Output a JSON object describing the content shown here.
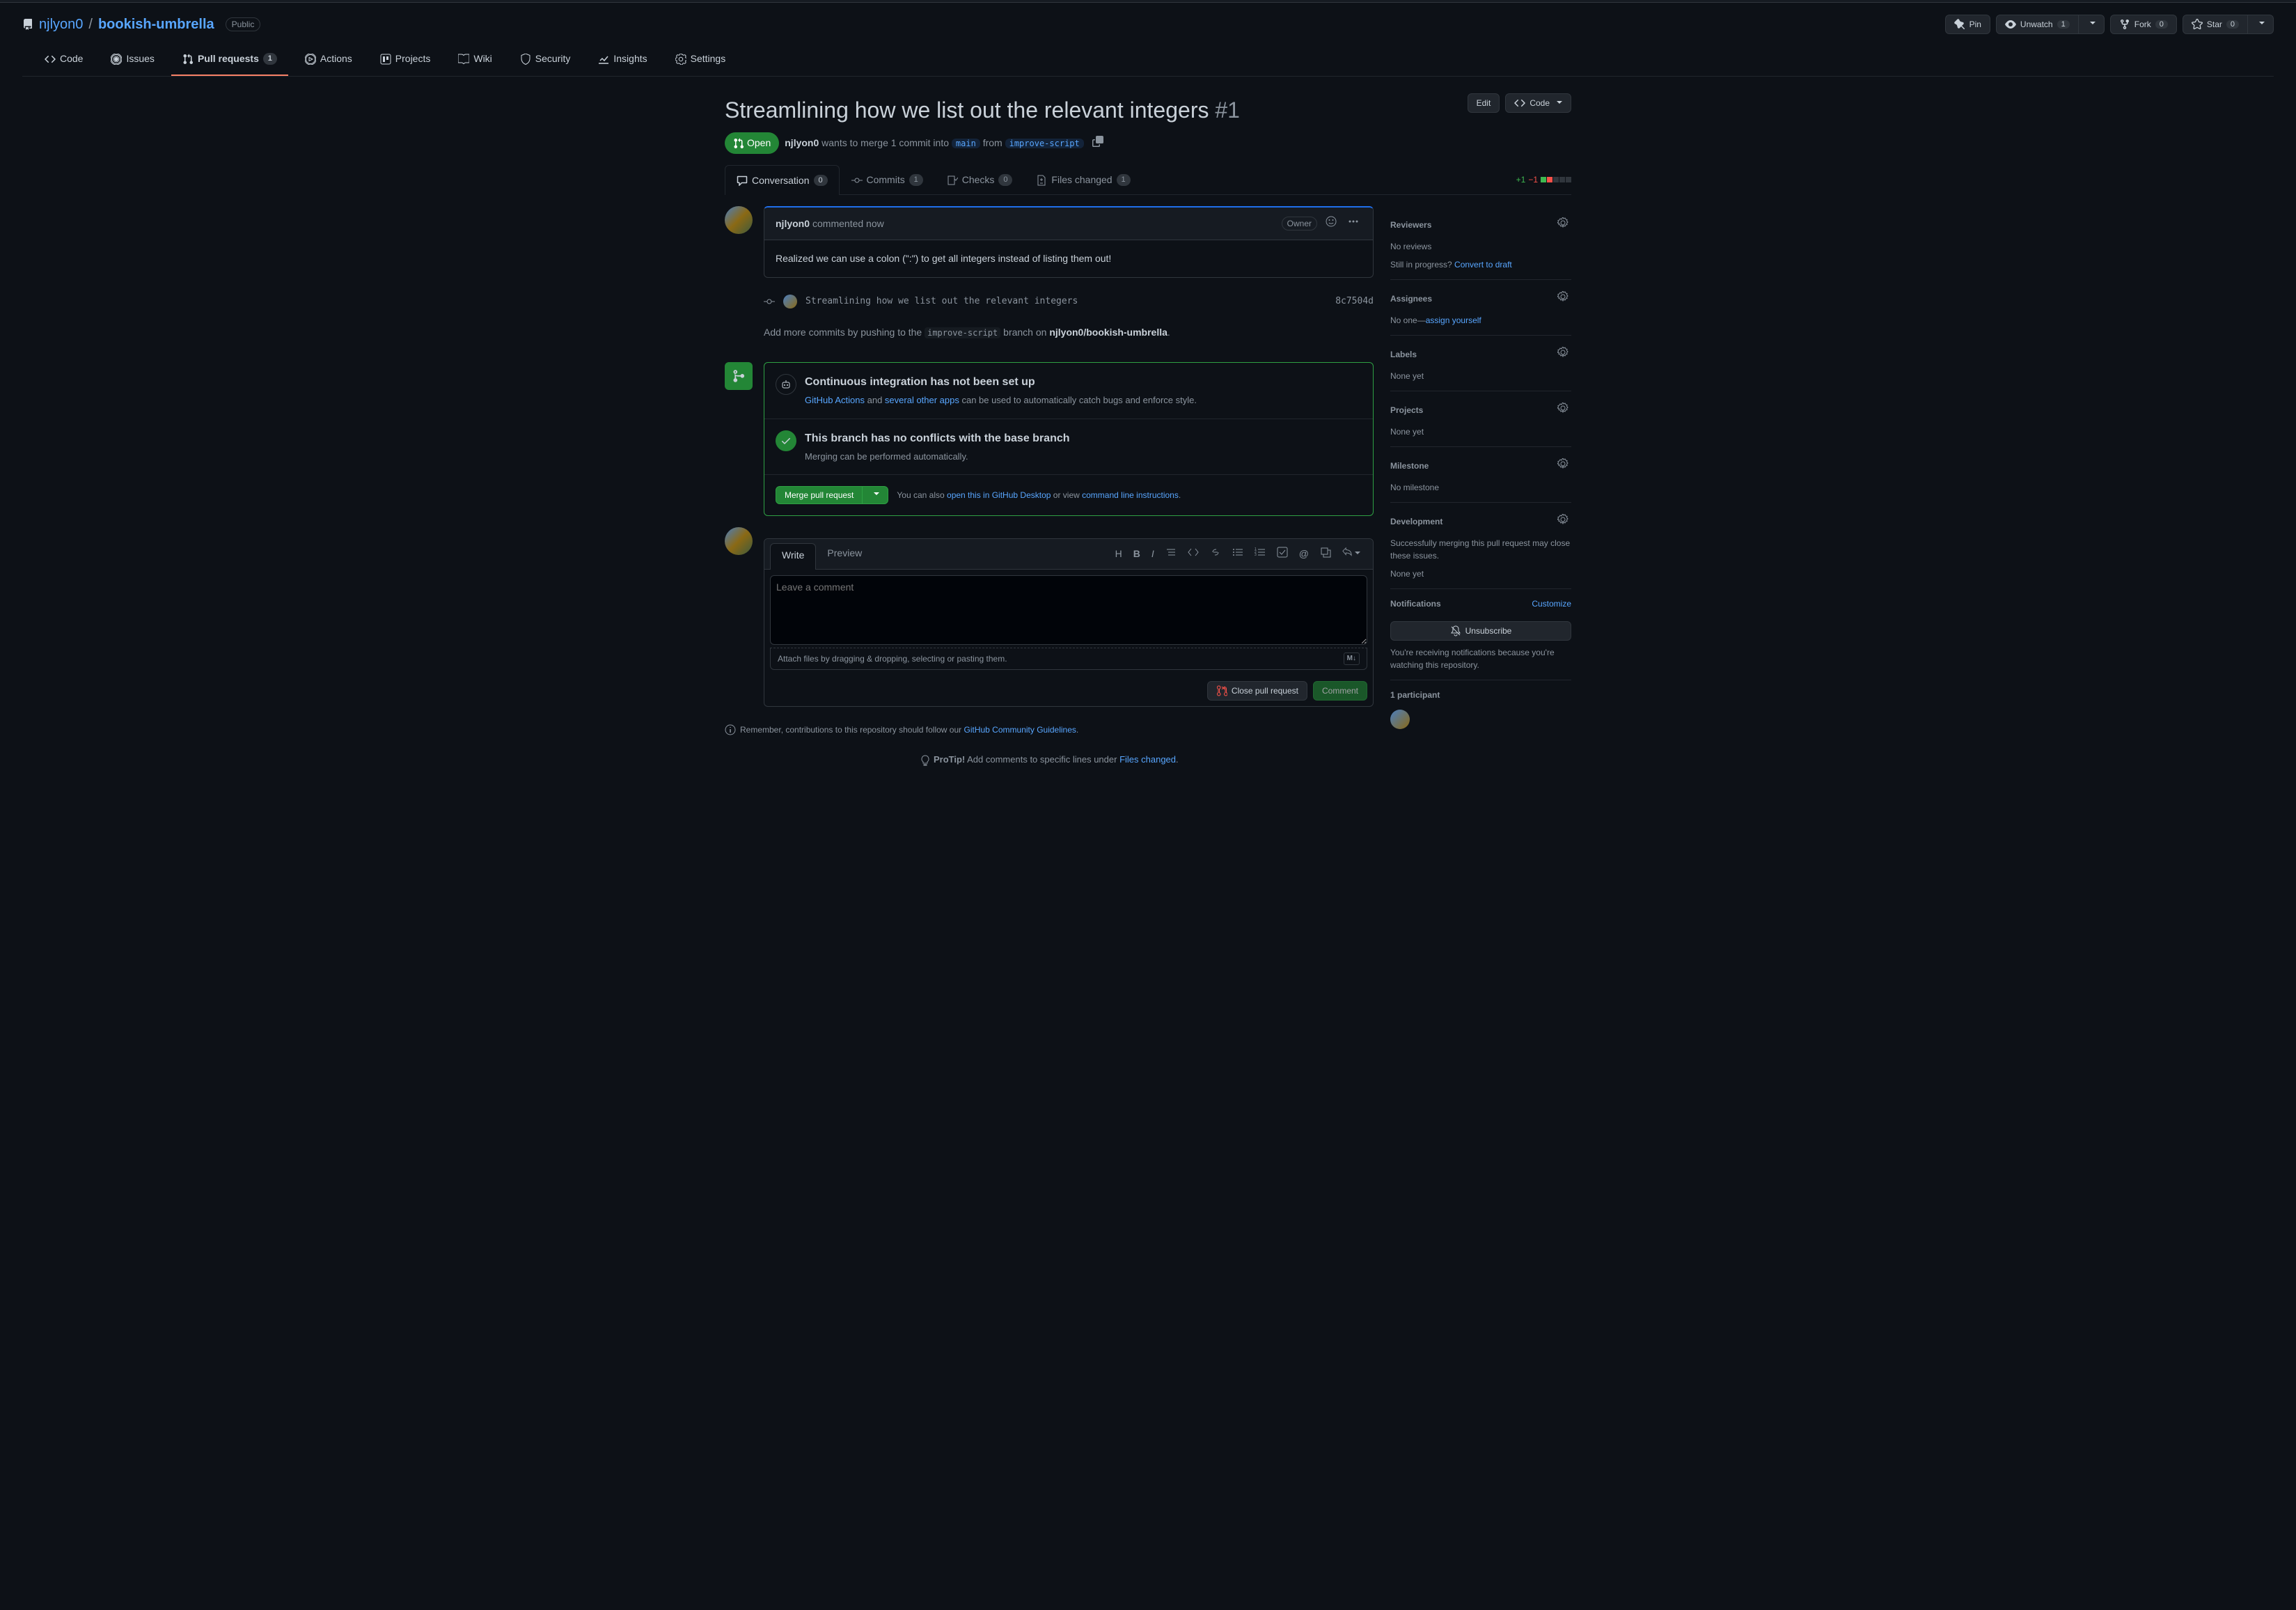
{
  "repo": {
    "owner": "njlyon0",
    "name": "bookish-umbrella",
    "visibility": "Public"
  },
  "repoActions": {
    "pin": "Pin",
    "watch": {
      "label": "Unwatch",
      "count": "1"
    },
    "fork": {
      "label": "Fork",
      "count": "0"
    },
    "star": {
      "label": "Star",
      "count": "0"
    }
  },
  "repoNav": {
    "code": "Code",
    "issues": "Issues",
    "pulls": {
      "label": "Pull requests",
      "count": "1"
    },
    "actions": "Actions",
    "projects": "Projects",
    "wiki": "Wiki",
    "security": "Security",
    "insights": "Insights",
    "settings": "Settings"
  },
  "pr": {
    "title": "Streamlining how we list out the relevant integers",
    "number": "#1",
    "state": "Open",
    "author": "njlyon0",
    "metaPrefix": " wants to merge 1 commit into ",
    "base": "main",
    "metaMiddle": " from ",
    "head": "improve-script",
    "editBtn": "Edit",
    "codeBtn": "Code"
  },
  "prTabs": {
    "conversation": {
      "label": "Conversation",
      "count": "0"
    },
    "commits": {
      "label": "Commits",
      "count": "1"
    },
    "checks": {
      "label": "Checks",
      "count": "0"
    },
    "files": {
      "label": "Files changed",
      "count": "1"
    }
  },
  "diffstat": {
    "add": "+1",
    "del": "−1"
  },
  "comment": {
    "author": "njlyon0",
    "timestamp": "commented now",
    "ownerBadge": "Owner",
    "body": "Realized we can use a colon (\":\") to get all integers instead of listing them out!"
  },
  "commit": {
    "message": "Streamlining how we list out the relevant integers",
    "sha": "8c7504d"
  },
  "pushHint": {
    "prefix": "Add more commits by pushing to the ",
    "branch": "improve-script",
    "middle": " branch on ",
    "repo": "njlyon0/bookish-umbrella",
    "suffix": "."
  },
  "ci": {
    "title": "Continuous integration has not been set up",
    "actionsLink": "GitHub Actions",
    "and": " and ",
    "appsLink": "several other apps",
    "rest": " can be used to automatically catch bugs and enforce style."
  },
  "conflicts": {
    "title": "This branch has no conflicts with the base branch",
    "subtitle": "Merging can be performed automatically."
  },
  "mergeActions": {
    "mergeBtn": "Merge pull request",
    "also": "You can also ",
    "desktopLink": "open this in GitHub Desktop",
    "or": " or view ",
    "cliLink": "command line instructions",
    "dot": "."
  },
  "commentForm": {
    "writeTab": "Write",
    "previewTab": "Preview",
    "placeholder": "Leave a comment",
    "attachHint": "Attach files by dragging & dropping, selecting or pasting them.",
    "closeBtn": "Close pull request",
    "commentBtn": "Comment",
    "mdBadge": "M↓"
  },
  "guideline": {
    "prefix": "Remember, contributions to this repository should follow our ",
    "link": "GitHub Community Guidelines",
    "suffix": "."
  },
  "protip": {
    "label": "ProTip!",
    "text": " Add comments to specific lines under ",
    "link": "Files changed",
    "suffix": "."
  },
  "sidebar": {
    "reviewers": {
      "title": "Reviewers",
      "body": "No reviews",
      "draft_prefix": "Still in progress? ",
      "draft_link": "Convert to draft"
    },
    "assignees": {
      "title": "Assignees",
      "body_prefix": "No one—",
      "body_link": "assign yourself"
    },
    "labels": {
      "title": "Labels",
      "body": "None yet"
    },
    "projects": {
      "title": "Projects",
      "body": "None yet"
    },
    "milestone": {
      "title": "Milestone",
      "body": "No milestone"
    },
    "development": {
      "title": "Development",
      "body": "Successfully merging this pull request may close these issues.",
      "none": "None yet"
    },
    "notifications": {
      "title": "Notifications",
      "customize": "Customize",
      "unsubscribe": "Unsubscribe",
      "note": "You're receiving notifications because you're watching this repository."
    },
    "participants": {
      "title": "1 participant"
    }
  }
}
